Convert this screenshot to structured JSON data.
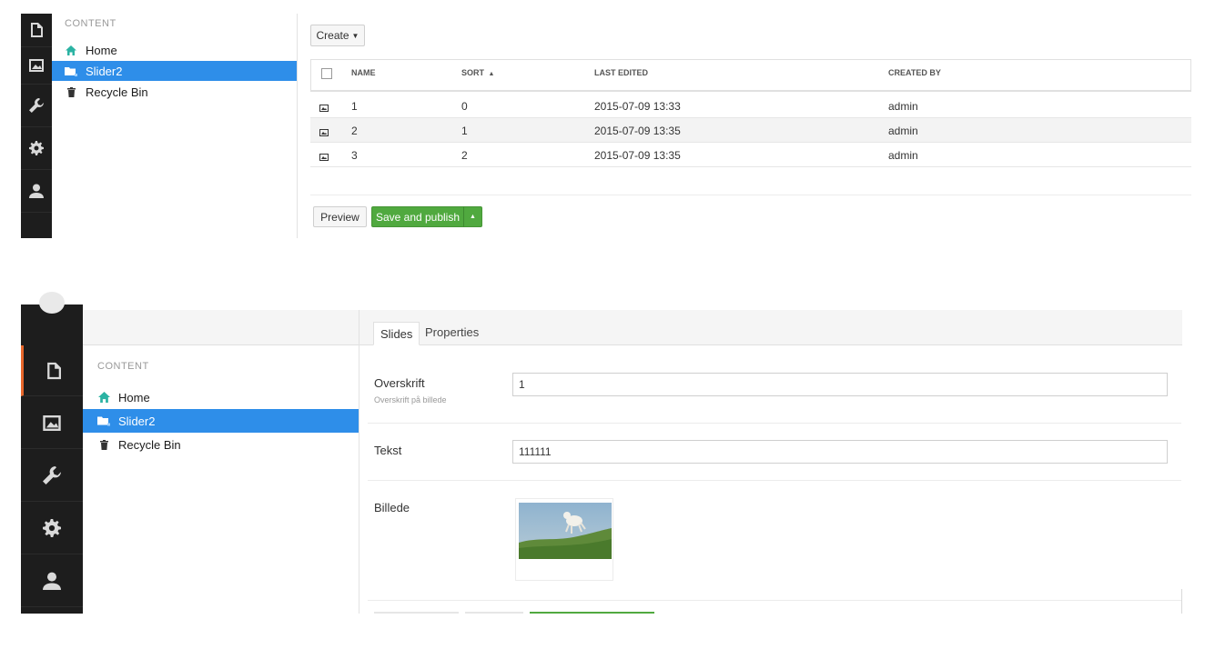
{
  "top": {
    "tree": {
      "header": "CONTENT",
      "items": [
        {
          "label": "Home",
          "icon": "home-icon"
        },
        {
          "label": "Slider2",
          "icon": "folder-icon"
        },
        {
          "label": "Recycle Bin",
          "icon": "trash-icon"
        }
      ]
    },
    "create_label": "Create",
    "table": {
      "columns": [
        "NAME",
        "SORT",
        "LAST EDITED",
        "CREATED BY"
      ],
      "rows": [
        {
          "name": "1",
          "sort": "0",
          "edited": "2015-07-09 13:33",
          "created_by": "admin"
        },
        {
          "name": "2",
          "sort": "1",
          "edited": "2015-07-09 13:35",
          "created_by": "admin"
        },
        {
          "name": "3",
          "sort": "2",
          "edited": "2015-07-09 13:35",
          "created_by": "admin"
        }
      ]
    },
    "preview_label": "Preview",
    "publish_label": "Save and publish"
  },
  "bottom": {
    "tree": {
      "header": "CONTENT",
      "items": [
        {
          "label": "Home",
          "icon": "home-icon"
        },
        {
          "label": "Slider2",
          "icon": "folder-icon"
        },
        {
          "label": "Recycle Bin",
          "icon": "trash-icon"
        }
      ]
    },
    "tabs": [
      "Slides",
      "Properties"
    ],
    "fields": {
      "overskrift": {
        "label": "Overskrift",
        "desc": "Overskrift på billede",
        "value": "1"
      },
      "tekst": {
        "label": "Tekst",
        "value": "111111"
      },
      "billede": {
        "label": "Billede"
      }
    }
  },
  "colors": {
    "accent_blue": "#2e8ee9",
    "green": "#50a93f",
    "rail": "#1d1d1d",
    "rail_active": "#e8672b"
  }
}
